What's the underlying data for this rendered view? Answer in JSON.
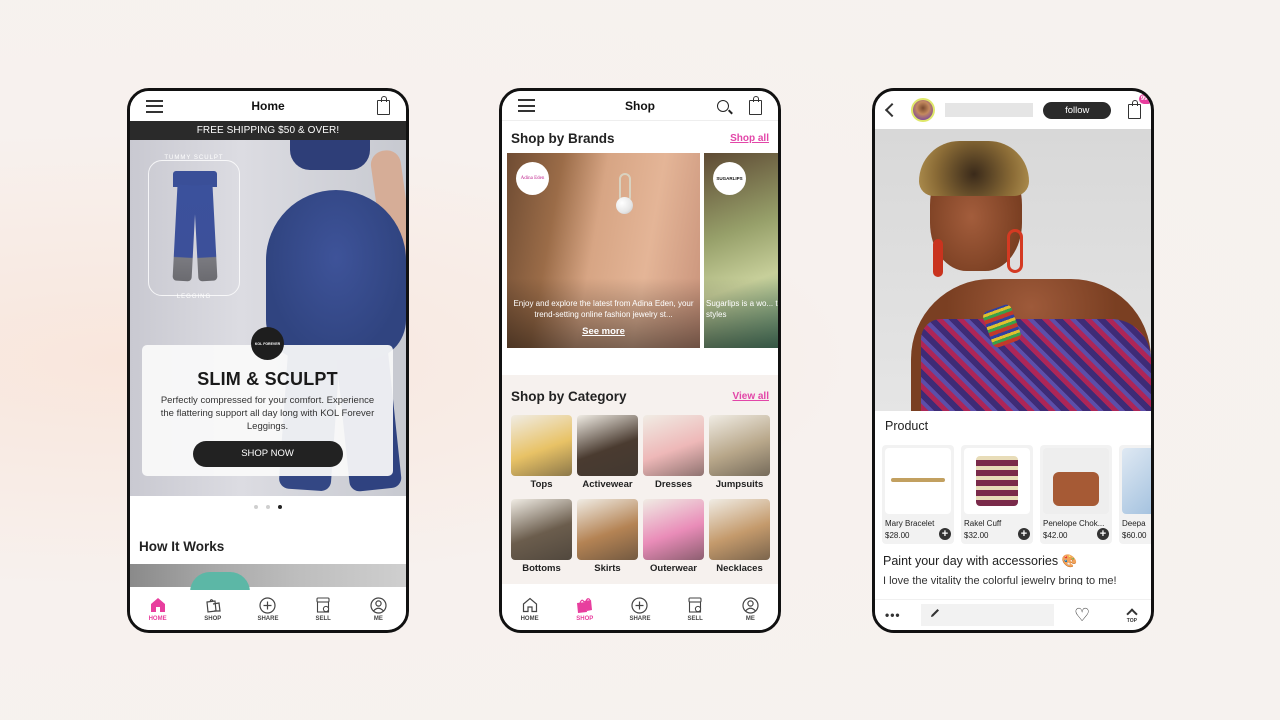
{
  "phones": {
    "home": {
      "header": {
        "title": "Home"
      },
      "promo_bar": "FREE SHIPPING $50 & OVER!",
      "hero": {
        "product_label_top": "TUMMY SCULPT",
        "product_label_bottom": "LEGGING",
        "brand_badge": "KOL FOREVER",
        "headline": "SLIM & SCULPT",
        "body": "Perfectly compressed for your comfort. Experience the flattering support all day long with KOL Forever Leggings.",
        "cta": "SHOP NOW",
        "carousel": {
          "total": 3,
          "active_index": 3
        }
      },
      "section_title": "How It Works"
    },
    "shop": {
      "header": {
        "title": "Shop"
      },
      "brands": {
        "title": "Shop by Brands",
        "link": "Shop all",
        "items": [
          {
            "logo": "Adina Eden",
            "description": "Enjoy and explore the latest from Adina Eden, your trend-setting online fashion jewelry st...",
            "link": "See more"
          },
          {
            "logo": "SUGARLIPS",
            "description": "Sugarlips is a wo... that offers the... styles"
          }
        ]
      },
      "categories": {
        "title": "Shop by Category",
        "link": "View all",
        "items": [
          {
            "label": "Tops",
            "color": "#e8c266"
          },
          {
            "label": "Activewear",
            "color": "#4a3b30"
          },
          {
            "label": "Dresses",
            "color": "#eeb8b8"
          },
          {
            "label": "Jumpsuits",
            "color": "#b8a78a"
          },
          {
            "label": "Bottoms",
            "color": "#6b5d4d"
          },
          {
            "label": "Skirts",
            "color": "#b48354"
          },
          {
            "label": "Outerwear",
            "color": "#e98cb8"
          },
          {
            "label": "Necklaces",
            "color": "#c49a6c"
          }
        ]
      }
    },
    "post": {
      "follow_label": "follow",
      "cart_badge": "99+",
      "product_section_title": "Product",
      "products": [
        {
          "name": "Mary Bracelet",
          "price": "$28.00"
        },
        {
          "name": "Rakel Cuff",
          "price": "$32.00"
        },
        {
          "name": "Penelope Chok...",
          "price": "$42.00"
        },
        {
          "name": "Deepa",
          "price": "$60.00"
        }
      ],
      "caption_title": "Paint your day with accessories 🎨",
      "caption_body": "I love the vitality the colorful jewelry bring to me!",
      "bottom": {
        "more": "•••",
        "top_label": "TOP"
      }
    }
  },
  "tabbar": {
    "items": [
      {
        "label": "HOME",
        "icon": "home-icon"
      },
      {
        "label": "SHOP",
        "icon": "shopping-bags-icon"
      },
      {
        "label": "SHARE",
        "icon": "plus-circle-icon"
      },
      {
        "label": "SELL",
        "icon": "storefront-icon"
      },
      {
        "label": "ME",
        "icon": "user-circle-icon"
      }
    ]
  },
  "colors": {
    "accent": "#e83e9e",
    "dark": "#2a2a2a",
    "background": "#f6f2ef"
  }
}
